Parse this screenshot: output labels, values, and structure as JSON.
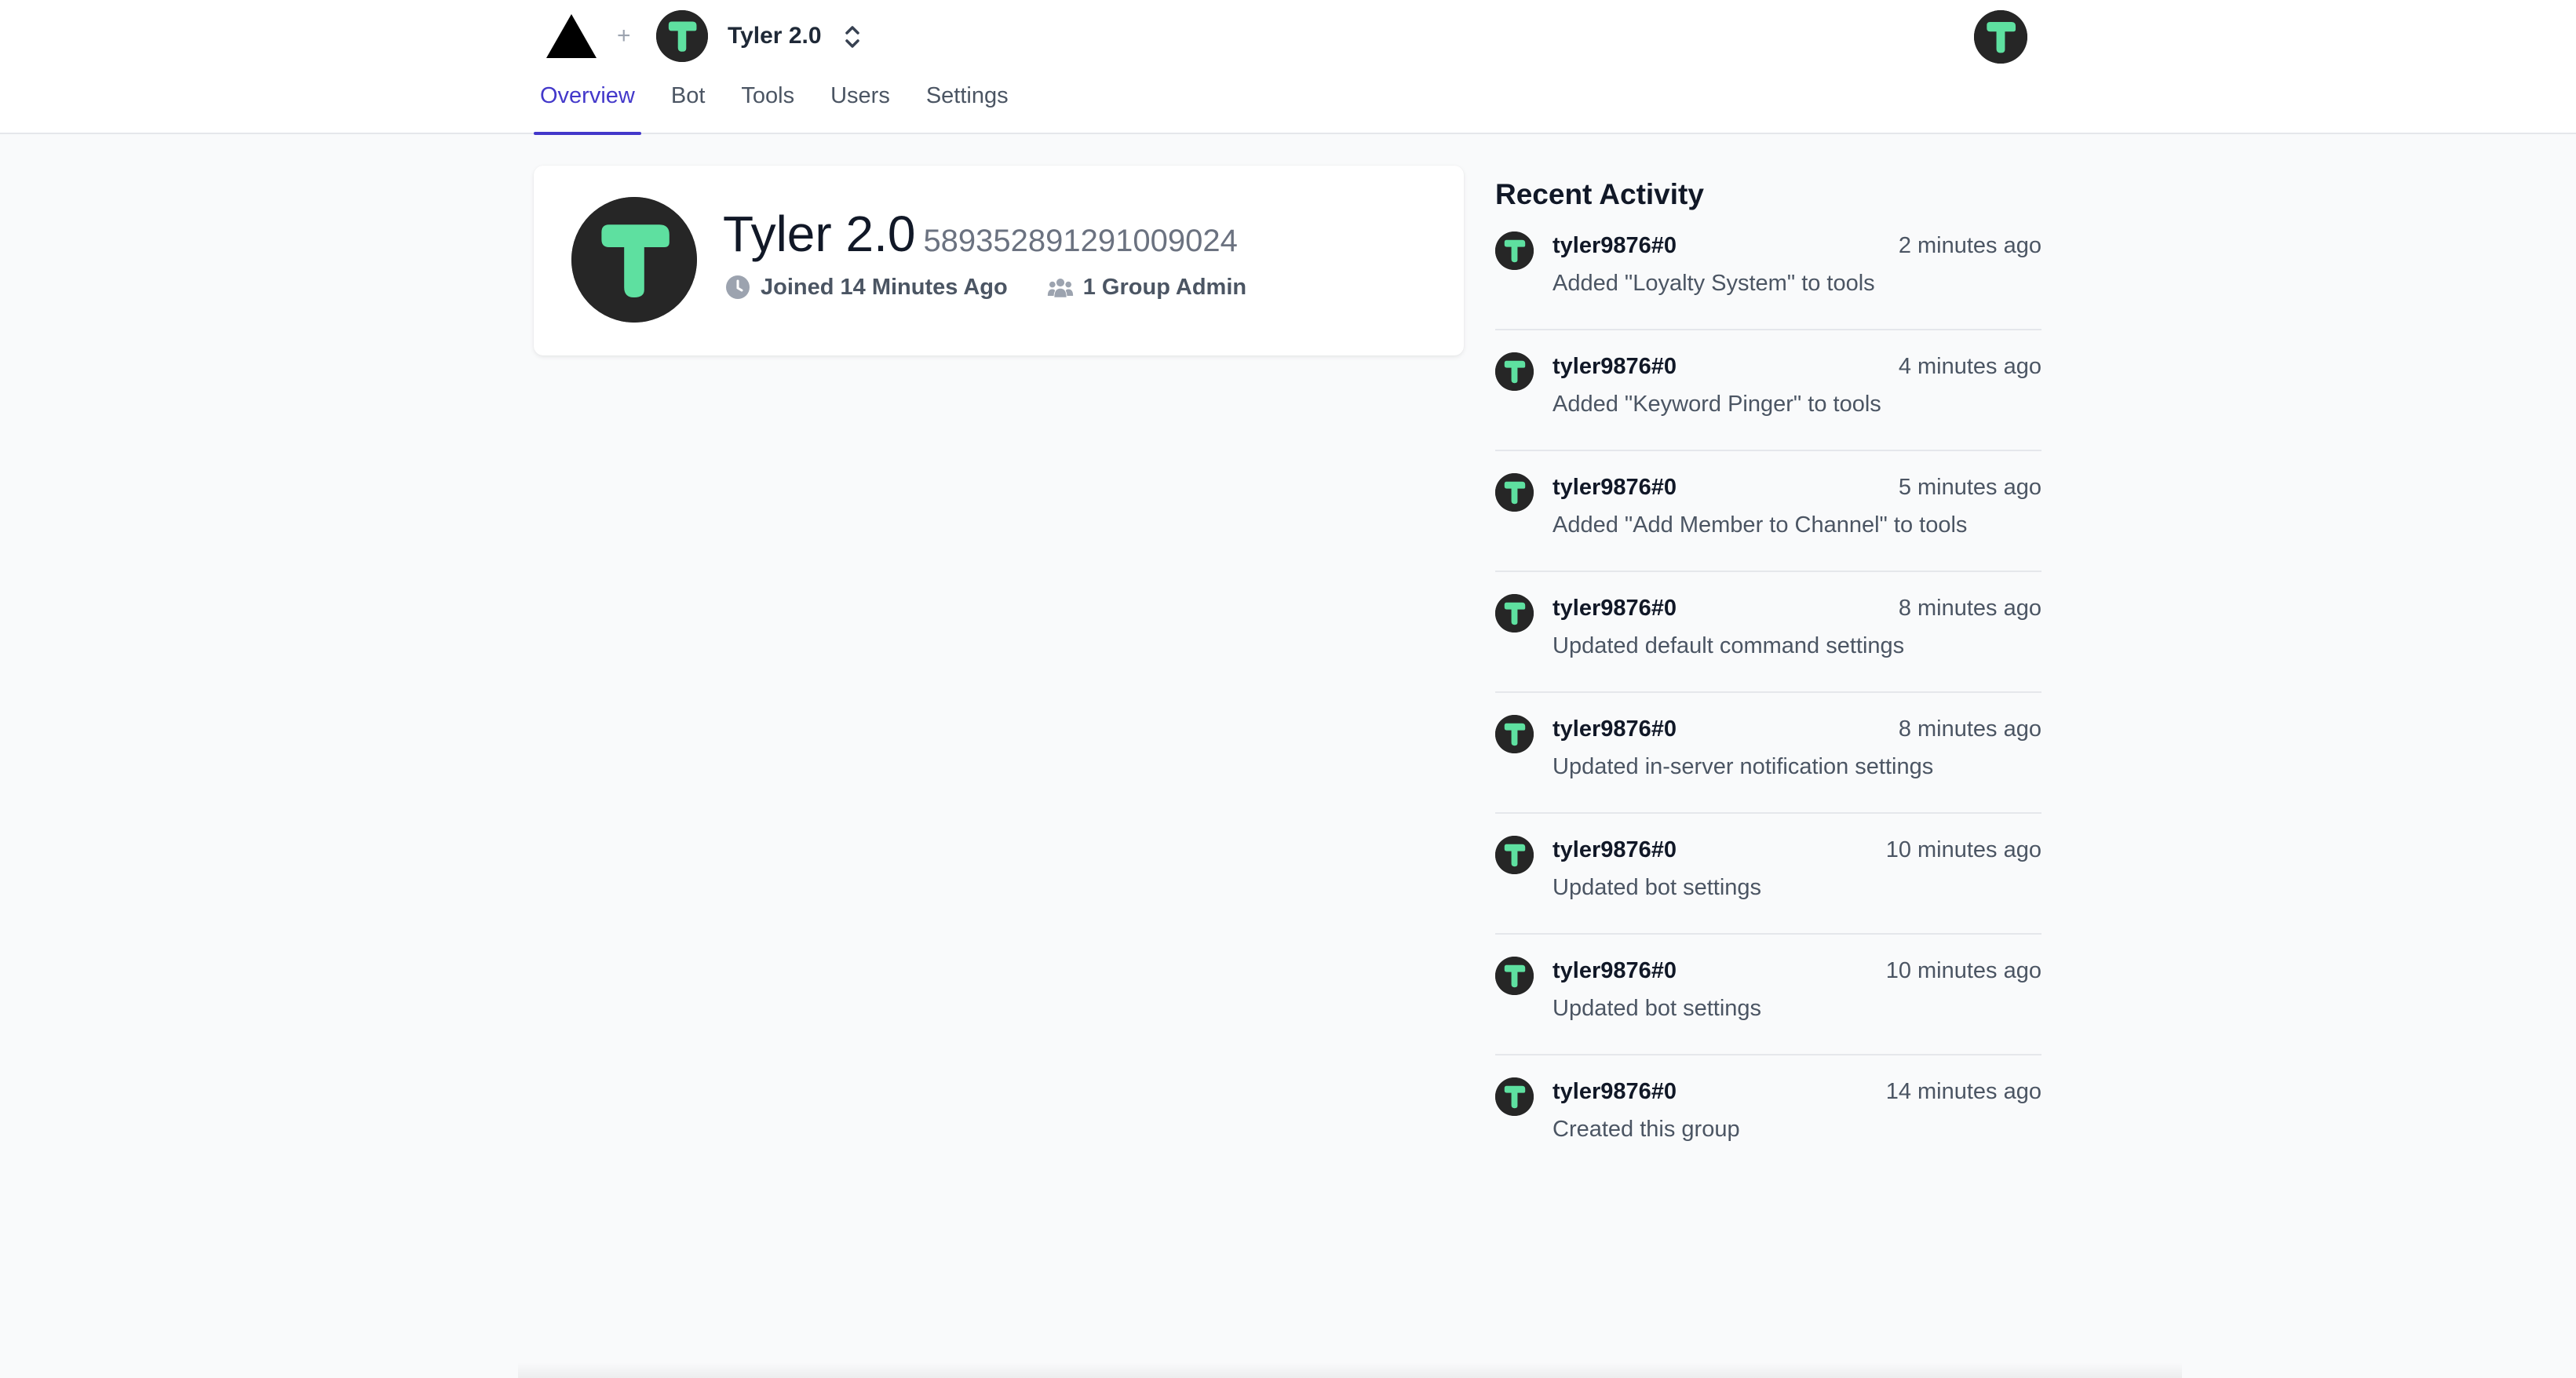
{
  "header": {
    "group_name": "Tyler 2.0",
    "plus": "+"
  },
  "tabs": [
    {
      "label": "Overview"
    },
    {
      "label": "Bot"
    },
    {
      "label": "Tools"
    },
    {
      "label": "Users"
    },
    {
      "label": "Settings"
    }
  ],
  "bot": {
    "name": "Tyler 2.0",
    "id": "589352891291009024",
    "joined": "Joined 14 Minutes Ago",
    "admins": "1 Group Admin"
  },
  "activity": {
    "title": "Recent Activity",
    "items": [
      {
        "user": "tyler9876#0",
        "time": "2 minutes ago",
        "desc": "Added \"Loyalty System\" to tools"
      },
      {
        "user": "tyler9876#0",
        "time": "4 minutes ago",
        "desc": "Added \"Keyword Pinger\" to tools"
      },
      {
        "user": "tyler9876#0",
        "time": "5 minutes ago",
        "desc": "Added \"Add Member to Channel\" to tools"
      },
      {
        "user": "tyler9876#0",
        "time": "8 minutes ago",
        "desc": "Updated default command settings"
      },
      {
        "user": "tyler9876#0",
        "time": "8 minutes ago",
        "desc": "Updated in-server notification settings"
      },
      {
        "user": "tyler9876#0",
        "time": "10 minutes ago",
        "desc": "Updated bot settings"
      },
      {
        "user": "tyler9876#0",
        "time": "10 minutes ago",
        "desc": "Updated bot settings"
      },
      {
        "user": "tyler9876#0",
        "time": "14 minutes ago",
        "desc": "Created this group"
      }
    ]
  },
  "colors": {
    "accent": "#4338ca",
    "avatar_bg": "#262626",
    "avatar_logo": "#5ee0a0"
  },
  "icons": {
    "logo": "triangle-logo-icon",
    "clock": "clock-icon",
    "users": "users-icon",
    "chevron": "chevron-up-down-icon"
  }
}
